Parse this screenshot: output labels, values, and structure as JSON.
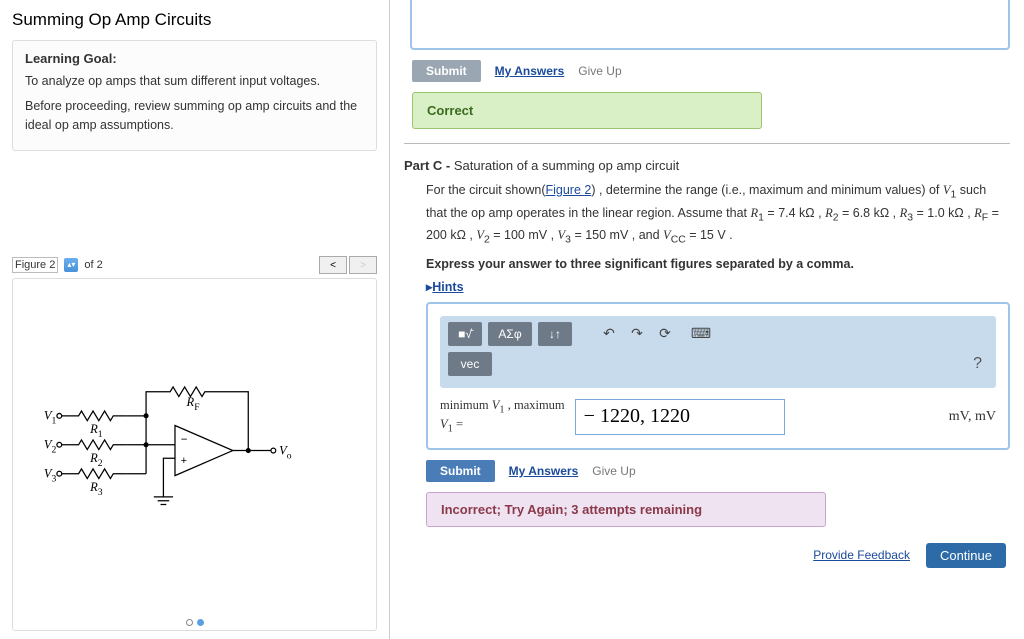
{
  "left": {
    "title": "Summing Op Amp Circuits",
    "goal_heading": "Learning Goal:",
    "goal_line1": "To analyze op amps that sum different input voltages.",
    "goal_line2": "Before proceeding, review summing op amp circuits and the ideal op amp assumptions.",
    "figure_label": "Figure 2",
    "figure_of": "of 2",
    "prev_label": "<",
    "next_label": ">",
    "circuit": {
      "v1": "V",
      "v1sub": "1",
      "v2": "V",
      "v2sub": "2",
      "v3": "V",
      "v3sub": "3",
      "r1": "R",
      "r1sub": "1",
      "r2": "R",
      "r2sub": "2",
      "r3": "R",
      "r3sub": "3",
      "rf": "R",
      "rfsub": "F",
      "vo": "V",
      "vosub": "o",
      "minus": "−",
      "plus": "+"
    }
  },
  "right": {
    "submit_label": "Submit",
    "my_answers": "My Answers",
    "give_up": "Give Up",
    "correct": "Correct",
    "part_prefix": "Part C - ",
    "part_title": "Saturation of a summing op amp circuit",
    "problem": {
      "intro": "For the circuit shown(",
      "figlink": "Figure 2",
      "cont1": ") , determine the range (i.e., maximum and minimum values) of ",
      "v1": "V",
      "v1sub": "1",
      "cont2": " such that the op amp operates in the linear region. Assume that ",
      "r1": "R",
      "r1sub": "1",
      "r1val": " = 7.4 kΩ , ",
      "r2": "R",
      "r2sub": "2",
      "r2val": " = 6.8 kΩ , ",
      "r3": "R",
      "r3sub": "3",
      "r3val": " = 1.0 kΩ , ",
      "rf": "R",
      "rfsub": "F",
      "rfval": " = 200 kΩ , ",
      "v2": "V",
      "v2sub": "2",
      "v2val": " = 100 mV , ",
      "v3": "V",
      "v3sub": "3",
      "v3val": " = 150 mV , and ",
      "vcc": "V",
      "vccsub": "CC",
      "vccval": " = 15 V ."
    },
    "express": "Express your answer to three significant figures separated by a comma.",
    "hints": "Hints",
    "toolbar": {
      "t1": "■√̄",
      "t2": "ΑΣφ",
      "t3": "↓↑",
      "undo": "↶",
      "redo": "↷",
      "reset": "⟳",
      "keyboard": "⌨",
      "vec": "vec",
      "help": "?"
    },
    "answer": {
      "label_line1": "minimum ",
      "label_v1": "V",
      "label_v1sub": "1",
      "label_max": " , maximum",
      "label_line2_v1": "V",
      "label_line2_sub": "1",
      "label_eq": " =",
      "value": "− 1220, 1220",
      "unit": "mV, mV"
    },
    "incorrect": "Incorrect; Try Again; 3 attempts remaining",
    "feedback": "Provide Feedback",
    "continue": "Continue"
  }
}
